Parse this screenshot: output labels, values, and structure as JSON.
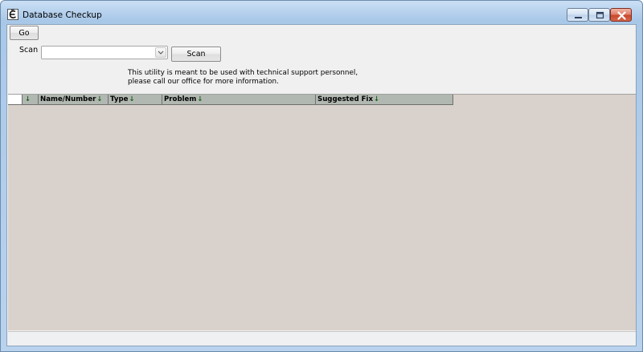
{
  "window": {
    "title": "Database Checkup",
    "icon": "app-e-icon"
  },
  "toolbar": {
    "go_label": "Go"
  },
  "scan": {
    "label": "Scan",
    "selected": "",
    "button_label": "Scan"
  },
  "info": {
    "line1": "This utility is meant to be used with technical support personnel,",
    "line2": "please call our office for more information."
  },
  "grid": {
    "columns": [
      {
        "label": "",
        "sort": "↓"
      },
      {
        "label": "Name/Number",
        "sort": "↓"
      },
      {
        "label": "Type",
        "sort": "↓"
      },
      {
        "label": "Problem",
        "sort": "↓"
      },
      {
        "label": "Suggested Fix",
        "sort": "↓"
      }
    ],
    "rows": []
  },
  "colors": {
    "grid_background": "#d9d1cb",
    "header_background": "#b1b8b1",
    "sort_arrow": "#1d5e1d"
  }
}
